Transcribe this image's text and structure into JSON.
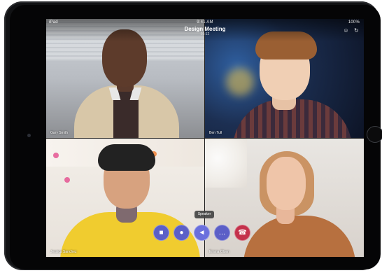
{
  "status_bar": {
    "left": "iPad",
    "time": "9:41 AM",
    "right": "100%"
  },
  "meeting": {
    "title": "Design Meeting",
    "duration": "01:12"
  },
  "participants": [
    {
      "name": "Gary Smith"
    },
    {
      "name": "Ben Tull"
    },
    {
      "name": "Jessica Sanchez"
    },
    {
      "name": "Emma Olsen"
    }
  ],
  "controls": {
    "tooltip": "Speaker",
    "buttons": [
      {
        "name": "camera",
        "icon": "video-camera-icon"
      },
      {
        "name": "microphone",
        "icon": "microphone-icon"
      },
      {
        "name": "speaker",
        "icon": "speaker-icon",
        "selected": true
      },
      {
        "name": "more",
        "icon": "more-icon"
      },
      {
        "name": "hang-up",
        "icon": "hang-up-icon"
      }
    ]
  },
  "colors": {
    "control_button": "#5b5fc7",
    "hang_up": "#c4314b"
  }
}
